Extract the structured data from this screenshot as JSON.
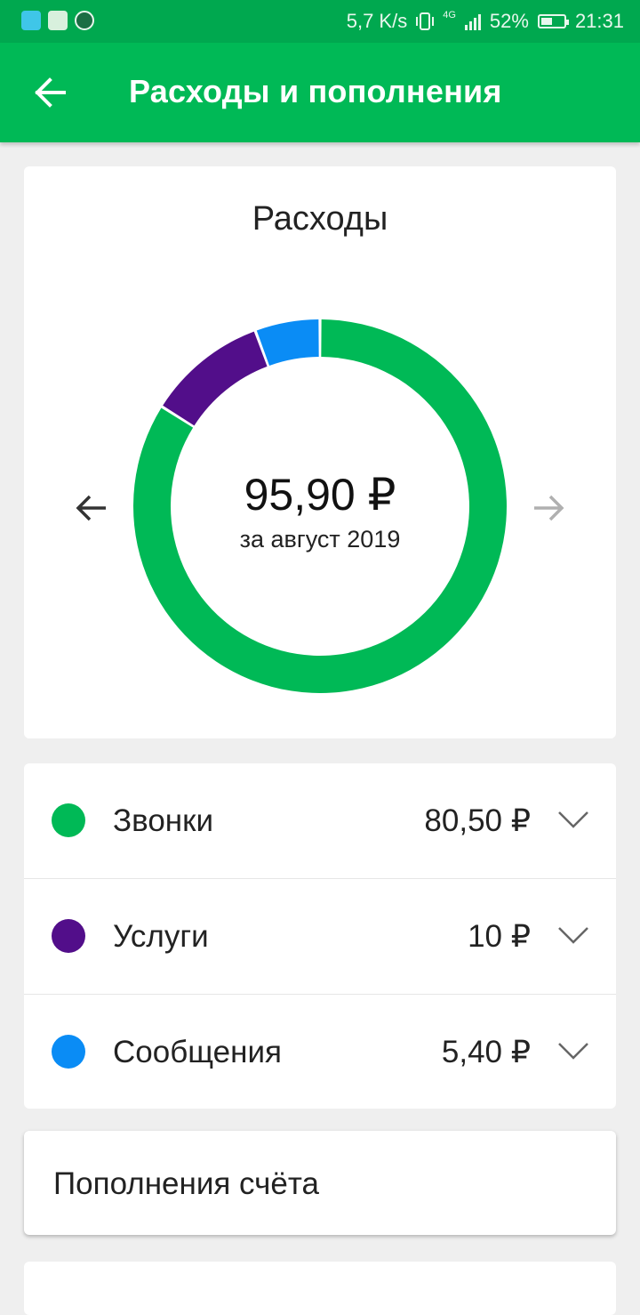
{
  "status_bar": {
    "speed": "5,7 K/s",
    "network": "4G",
    "battery": "52%",
    "battery_level": 0.52,
    "time": "21:31"
  },
  "toolbar": {
    "title": "Расходы и пополнения",
    "back_icon": "arrow-left-icon"
  },
  "expenses": {
    "title": "Расходы",
    "total": "95,90 ₽",
    "period": "за август 2019",
    "prev_icon": "arrow-left-icon",
    "next_icon": "arrow-right-icon"
  },
  "chart_data": {
    "type": "pie",
    "categories": [
      "Звонки",
      "Услуги",
      "Сообщения"
    ],
    "values": [
      80.5,
      10,
      5.4
    ],
    "colors": [
      "#00b956",
      "#520e8a",
      "#0a8cf5"
    ],
    "title": "Расходы"
  },
  "categories": [
    {
      "label": "Звонки",
      "amount": "80,50 ₽",
      "color": "#00b956"
    },
    {
      "label": "Услуги",
      "amount": "10 ₽",
      "color": "#520e8a"
    },
    {
      "label": "Сообщения",
      "amount": "5,40 ₽",
      "color": "#0a8cf5"
    }
  ],
  "topups": {
    "title": "Пополнения счёта"
  },
  "colors": {
    "brand_green": "#00b956",
    "status_green": "#00a84f",
    "background": "#efefef"
  }
}
